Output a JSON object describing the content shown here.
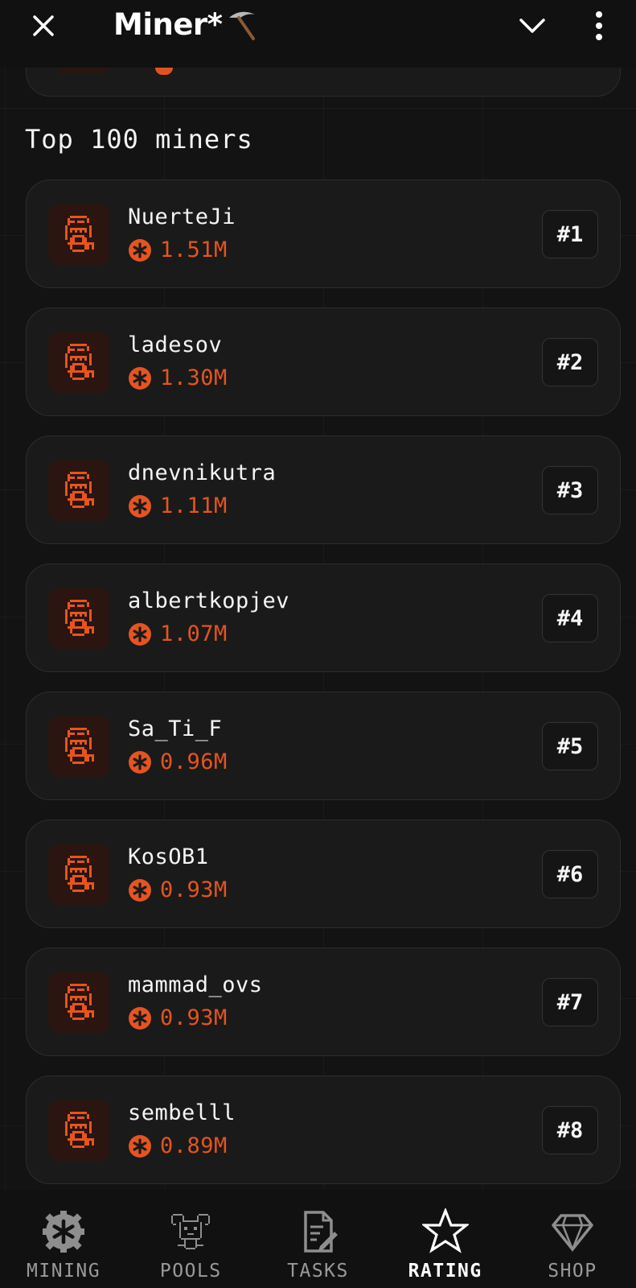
{
  "header": {
    "title": "Miner*⛏️",
    "title_text": "Miner*",
    "close_icon": "close-icon",
    "chevron_icon": "chevron-down-icon",
    "more_icon": "more-vertical-icon"
  },
  "section_title": "Top 100 miners",
  "miners": [
    {
      "name": "NuerteJi",
      "score": "1.51M",
      "rank": "#1"
    },
    {
      "name": "ladesov",
      "score": "1.30M",
      "rank": "#2"
    },
    {
      "name": "dnevnikutra",
      "score": "1.11M",
      "rank": "#3"
    },
    {
      "name": "albertkopjev",
      "score": "1.07M",
      "rank": "#4"
    },
    {
      "name": "Sa_Ti_F",
      "score": "0.96M",
      "rank": "#5"
    },
    {
      "name": "KosOB1",
      "score": "0.93M",
      "rank": "#6"
    },
    {
      "name": "mammad_ovs",
      "score": "0.93M",
      "rank": "#7"
    },
    {
      "name": "sembelll",
      "score": "0.89M",
      "rank": "#8"
    }
  ],
  "nav": [
    {
      "label": "MINING",
      "icon": "gear-asterisk-icon",
      "active": false
    },
    {
      "label": "POOLS",
      "icon": "pools-mascot-icon",
      "active": false
    },
    {
      "label": "TASKS",
      "icon": "tasks-document-icon",
      "active": false
    },
    {
      "label": "RATING",
      "icon": "star-icon",
      "active": true
    },
    {
      "label": "SHOP",
      "icon": "diamond-icon",
      "active": false
    }
  ],
  "colors": {
    "accent": "#e4551f",
    "background": "#121212",
    "card": "#1a1a1a"
  }
}
